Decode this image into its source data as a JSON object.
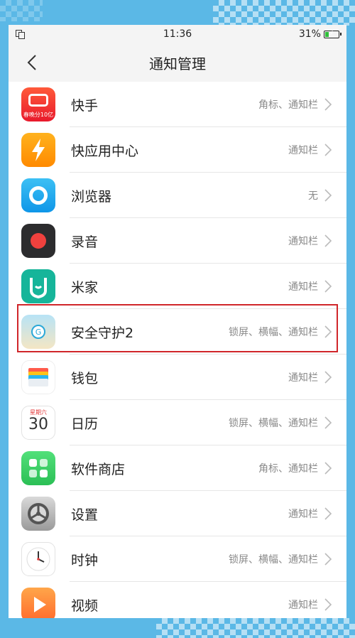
{
  "status_bar": {
    "time": "11:36",
    "battery": "31%",
    "battery_level": 0.31
  },
  "header": {
    "title": "通知管理"
  },
  "apps": [
    {
      "name": "快手",
      "status": "角标、通知栏",
      "icon": "kuaishou-icon",
      "icon_text": "春晚分10亿"
    },
    {
      "name": "快应用中心",
      "status": "通知栏",
      "icon": "quick-app-icon"
    },
    {
      "name": "浏览器",
      "status": "无",
      "icon": "browser-icon"
    },
    {
      "name": "录音",
      "status": "通知栏",
      "icon": "recorder-icon"
    },
    {
      "name": "米家",
      "status": "通知栏",
      "icon": "mijia-icon"
    },
    {
      "name": "安全守护2",
      "status": "锁屏、横幅、通知栏",
      "icon": "security-guard-icon"
    },
    {
      "name": "钱包",
      "status": "通知栏",
      "icon": "wallet-icon"
    },
    {
      "name": "日历",
      "status": "锁屏、横幅、通知栏",
      "icon": "calendar-icon",
      "icon_weekday": "星期六",
      "icon_day": "30"
    },
    {
      "name": "软件商店",
      "status": "角标、通知栏",
      "icon": "app-store-icon"
    },
    {
      "name": "设置",
      "status": "通知栏",
      "icon": "settings-icon"
    },
    {
      "name": "时钟",
      "status": "锁屏、横幅、通知栏",
      "icon": "clock-icon"
    },
    {
      "name": "视频",
      "status": "通知栏",
      "icon": "video-icon"
    }
  ],
  "colors": {
    "highlight_border": "#d0262a",
    "background": "#5bb8e6"
  }
}
